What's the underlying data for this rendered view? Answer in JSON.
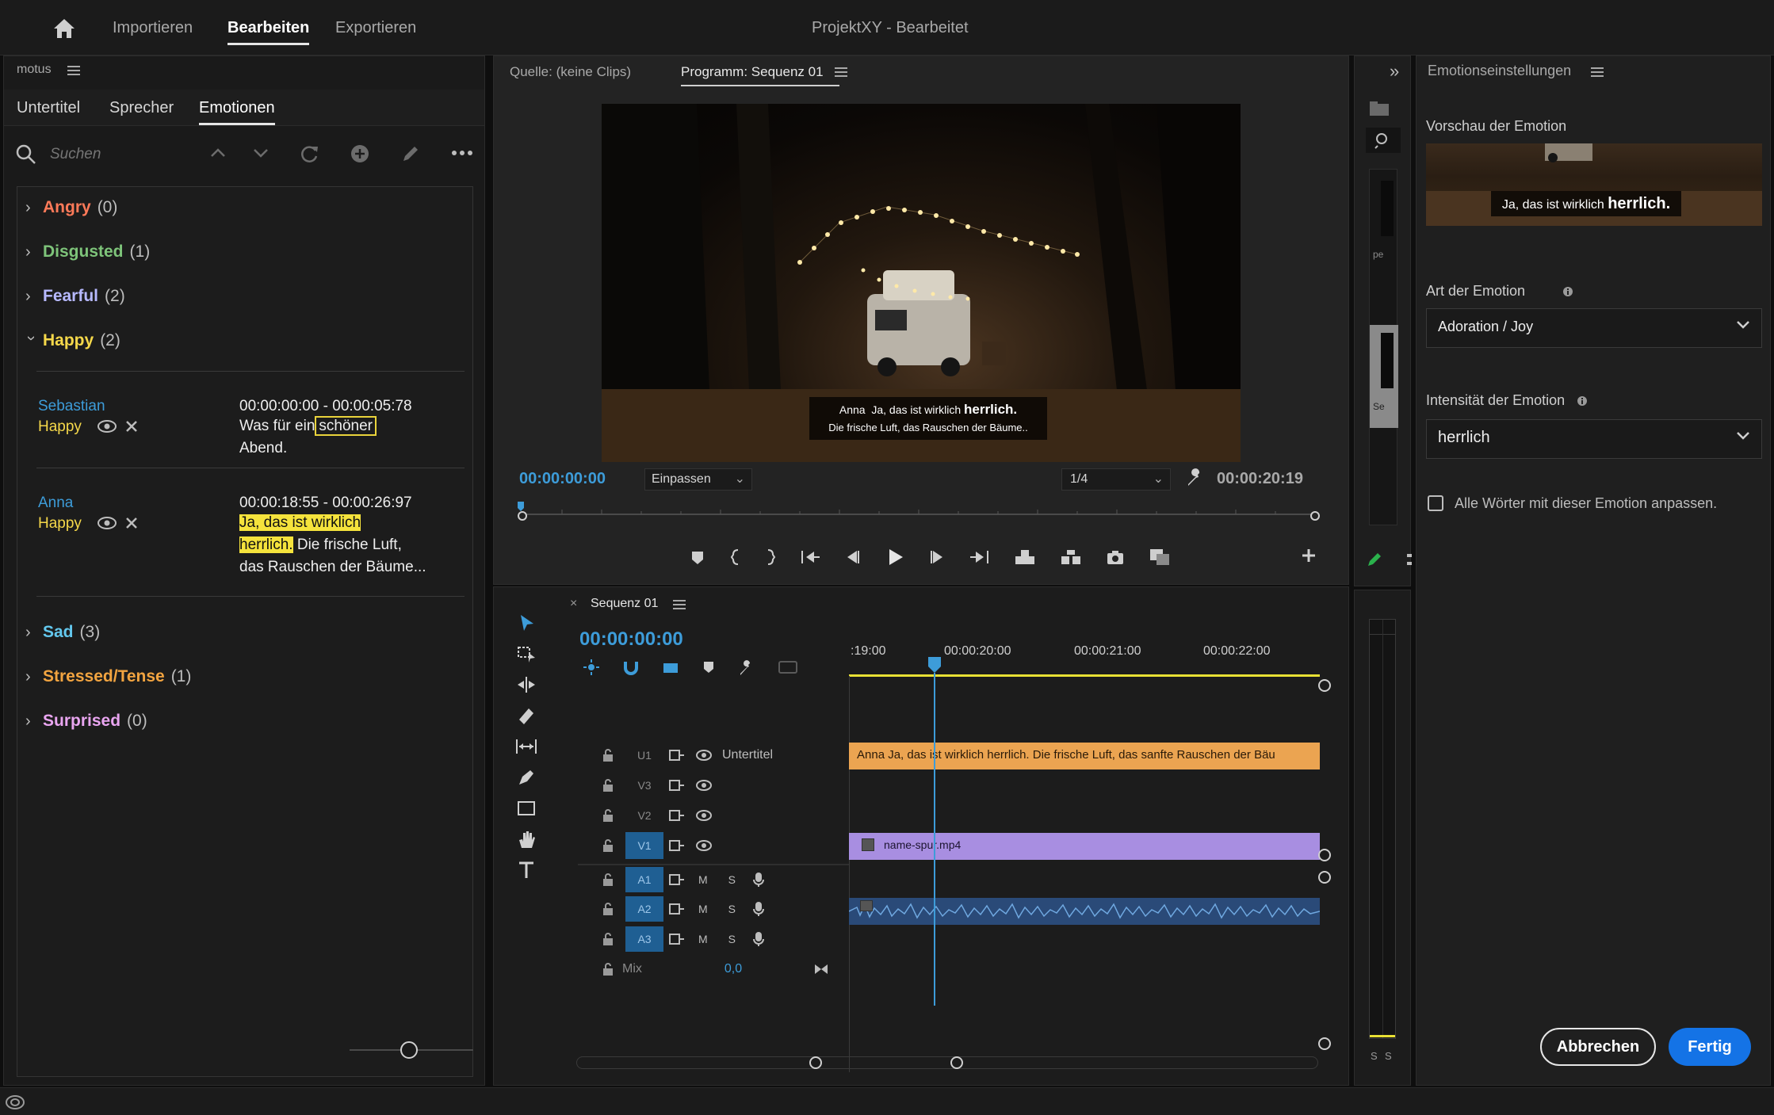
{
  "topbar": {
    "tabs": [
      {
        "label": "Importieren"
      },
      {
        "label": "Bearbeiten"
      },
      {
        "label": "Exportieren"
      }
    ],
    "title": "ProjektXY - Bearbeitet"
  },
  "left_panel": {
    "title": "motus",
    "tabs": [
      {
        "label": "Untertitel"
      },
      {
        "label": "Sprecher"
      },
      {
        "label": "Emotionen"
      }
    ],
    "search_placeholder": "Suchen",
    "categories": [
      {
        "name": "Angry",
        "count": "(0)",
        "color": "#ff7a59",
        "expanded": false
      },
      {
        "name": "Disgusted",
        "count": "(1)",
        "color": "#7ec47a",
        "expanded": false
      },
      {
        "name": "Fearful",
        "count": "(2)",
        "color": "#b7b9ff",
        "expanded": false
      },
      {
        "name": "Happy",
        "count": "(2)",
        "color": "#f5d84a",
        "expanded": true
      },
      {
        "name": "Sad",
        "count": "(3)",
        "color": "#63c8ee",
        "expanded": false
      },
      {
        "name": "Stressed/Tense",
        "count": "(1)",
        "color": "#f2a440",
        "expanded": false
      },
      {
        "name": "Surprised",
        "count": "(0)",
        "color": "#e9a5f0",
        "expanded": false
      }
    ],
    "entries": [
      {
        "speaker": "Sebastian",
        "emotion": "Happy",
        "timecode": "00:00:00:00 - 00:00:05:78",
        "text_before": "Was für ein",
        "text_highlight": "schöner",
        "text_after": "Abend."
      },
      {
        "speaker": "Anna",
        "emotion": "Happy",
        "timecode": "00:00:18:55 - 00:00:26:97",
        "text_hl1": "Ja, das ist wirklich",
        "text_hl2": "herrlich.",
        "text_after": "Die frische Luft, das Rauschen der Bäume..."
      }
    ]
  },
  "program_monitor": {
    "tab_source": "Quelle: (keine Clips)",
    "tab_program": "Programm: Sequenz 01",
    "subtitle_speaker": "Anna",
    "subtitle_line1_pre": "Ja, das ist wirklich",
    "subtitle_line1_emph": "herrlich.",
    "subtitle_line2": "Die frische Luft, das Rauschen der Bäume..",
    "timecode": "00:00:00:00",
    "fit": "Einpassen",
    "resolution": "1/4",
    "duration": "00:00:20:19"
  },
  "timeline": {
    "tab": "Sequenz 01",
    "timecode": "00:00:00:00",
    "ruler": [
      ":19:00",
      "00:00:20:00",
      "00:00:21:00",
      "00:00:22:00"
    ],
    "tracks": [
      {
        "id": "U1",
        "name": "Untertitel"
      },
      {
        "id": "V3",
        "name": ""
      },
      {
        "id": "V2",
        "name": ""
      },
      {
        "id": "V1",
        "name": ""
      },
      {
        "id": "A1",
        "name": ""
      },
      {
        "id": "A2",
        "name": ""
      },
      {
        "id": "A3",
        "name": ""
      }
    ],
    "mix_label": "Mix",
    "mix_value": "0,0",
    "mute_label": "M",
    "solo_label": "S",
    "subtitle_clip": "Anna   Ja, das ist wirklich herrlich. Die frische Luft, das sanfte Rauschen der Bäu",
    "video_clip": "name-spur.mp4"
  },
  "right_panel": {
    "title": "Emotionseinstellungen",
    "preview_label": "Vorschau der Emotion",
    "preview_text_pre": "Ja, das ist wirklich",
    "preview_text_emph": "herrlich.",
    "type_label": "Art der Emotion",
    "type_value": "Adoration / Joy",
    "intensity_label": "Intensität der Emotion",
    "intensity_value": "herrlich",
    "checkbox_label": "Alle Wörter mit dieser Emotion anpassen.",
    "cancel": "Abbrechen",
    "done": "Fertig"
  },
  "narrow_panel": {
    "text1": "pe",
    "text2": "Se"
  },
  "meter": {
    "label_left": "S",
    "label_right": "S"
  }
}
